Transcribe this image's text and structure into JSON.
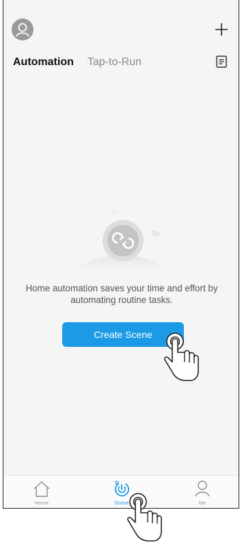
{
  "tabs": {
    "automation": "Automation",
    "tap_to_run": "Tap-to-Run"
  },
  "empty_state": {
    "message": "Home automation saves your time and effort by automating routine tasks."
  },
  "create_button": {
    "label": "Create Scene"
  },
  "tabbar": {
    "home": "Home",
    "scene": "Scene",
    "me": "Me"
  },
  "icons": {
    "avatar": "user-avatar-icon",
    "add": "plus-icon",
    "log": "document-icon",
    "home": "home-icon",
    "scene": "scene-power-icon",
    "me": "person-icon",
    "pointer": "tap-hand-icon"
  },
  "colors": {
    "accent": "#1c9ae6",
    "background": "#f5f5f5",
    "inactive": "#999999"
  }
}
